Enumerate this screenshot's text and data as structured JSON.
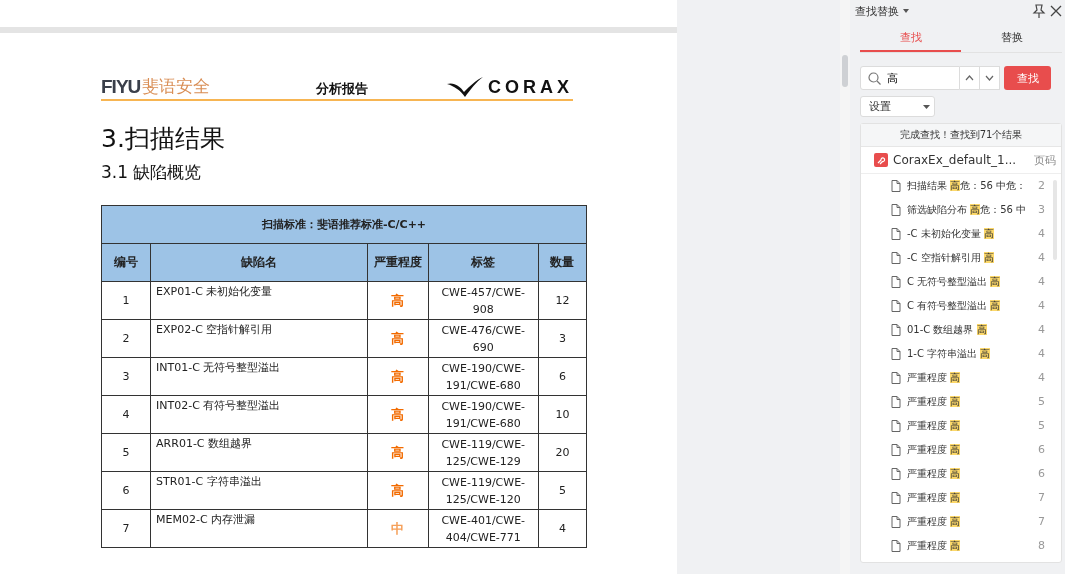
{
  "document": {
    "header": {
      "brand_cn": "斐语安全",
      "brand_latin": "FIYU",
      "center": "分析报告",
      "right_logo": "CORAX"
    },
    "heading": "3.扫描结果",
    "subheading": "3.1 缺陷概览",
    "table": {
      "caption": "扫描标准：斐语推荐标准-C/C++",
      "columns": [
        "编号",
        "缺陷名",
        "严重程度",
        "标签",
        "数量"
      ],
      "rows": [
        {
          "no": "1",
          "name": "EXP01-C 未初始化变量",
          "severity": "高",
          "color": "#f26b00",
          "tags": "CWE-457/CWE-908",
          "count": "12"
        },
        {
          "no": "2",
          "name": "EXP02-C 空指针解引用",
          "severity": "高",
          "color": "#f26b00",
          "tags": "CWE-476/CWE-690",
          "count": "3"
        },
        {
          "no": "3",
          "name": "INT01-C 无符号整型溢出",
          "severity": "高",
          "color": "#f26b00",
          "tags": "CWE-190/CWE-191/CWE-680",
          "count": "6"
        },
        {
          "no": "4",
          "name": "INT02-C 有符号整型溢出",
          "severity": "高",
          "color": "#f26b00",
          "tags": "CWE-190/CWE-191/CWE-680",
          "count": "10"
        },
        {
          "no": "5",
          "name": "ARR01-C 数组越界",
          "severity": "高",
          "color": "#f26b00",
          "tags": "CWE-119/CWE-125/CWE-129",
          "count": "20"
        },
        {
          "no": "6",
          "name": "STR01-C 字符串溢出",
          "severity": "高",
          "color": "#f26b00",
          "tags": "CWE-119/CWE-125/CWE-120",
          "count": "5"
        },
        {
          "no": "7",
          "name": "MEM02-C 内存泄漏",
          "severity": "中",
          "color": "#f5a05a",
          "tags": "CWE-401/CWE-404/CWE-771",
          "count": "4"
        }
      ]
    }
  },
  "panel": {
    "title": "查找替换",
    "tabs": [
      {
        "label": "查找",
        "selected": true
      },
      {
        "label": "替换",
        "selected": false
      }
    ],
    "search": {
      "value": "高"
    },
    "find_button": "查找",
    "settings": "设置",
    "status": "完成查找！查找到71个结果",
    "file": {
      "name": "CoraxEx_default_1...",
      "page_header": "页码"
    },
    "results": [
      {
        "before": "扫描结果 ",
        "match": "高",
        "after": "危：56 中危：",
        "page": "2"
      },
      {
        "before": "筛选缺陷分布 ",
        "match": "高",
        "after": "危：56 中",
        "page": "3"
      },
      {
        "before": "-C 未初始化变量 ",
        "match": "高",
        "page": "4"
      },
      {
        "before": "-C 空指针解引用 ",
        "match": "高",
        "page": "4"
      },
      {
        "before": "C 无符号整型溢出 ",
        "match": "高",
        "page": "4"
      },
      {
        "before": "C 有符号整型溢出 ",
        "match": "高",
        "page": "4"
      },
      {
        "before": "01-C 数组越界 ",
        "match": "高",
        "page": "4"
      },
      {
        "before": "1-C 字符串溢出 ",
        "match": "高",
        "page": "4"
      },
      {
        "before": "严重程度 ",
        "match": "高",
        "page": "4"
      },
      {
        "before": "严重程度 ",
        "match": "高",
        "page": "5"
      },
      {
        "before": "严重程度 ",
        "match": "高",
        "page": "5"
      },
      {
        "before": "严重程度 ",
        "match": "高",
        "page": "6"
      },
      {
        "before": "严重程度 ",
        "match": "高",
        "page": "6"
      },
      {
        "before": "严重程度 ",
        "match": "高",
        "page": "7"
      },
      {
        "before": "严重程度 ",
        "match": "高",
        "page": "7"
      },
      {
        "before": "严重程度 ",
        "match": "高",
        "page": "8"
      }
    ]
  }
}
